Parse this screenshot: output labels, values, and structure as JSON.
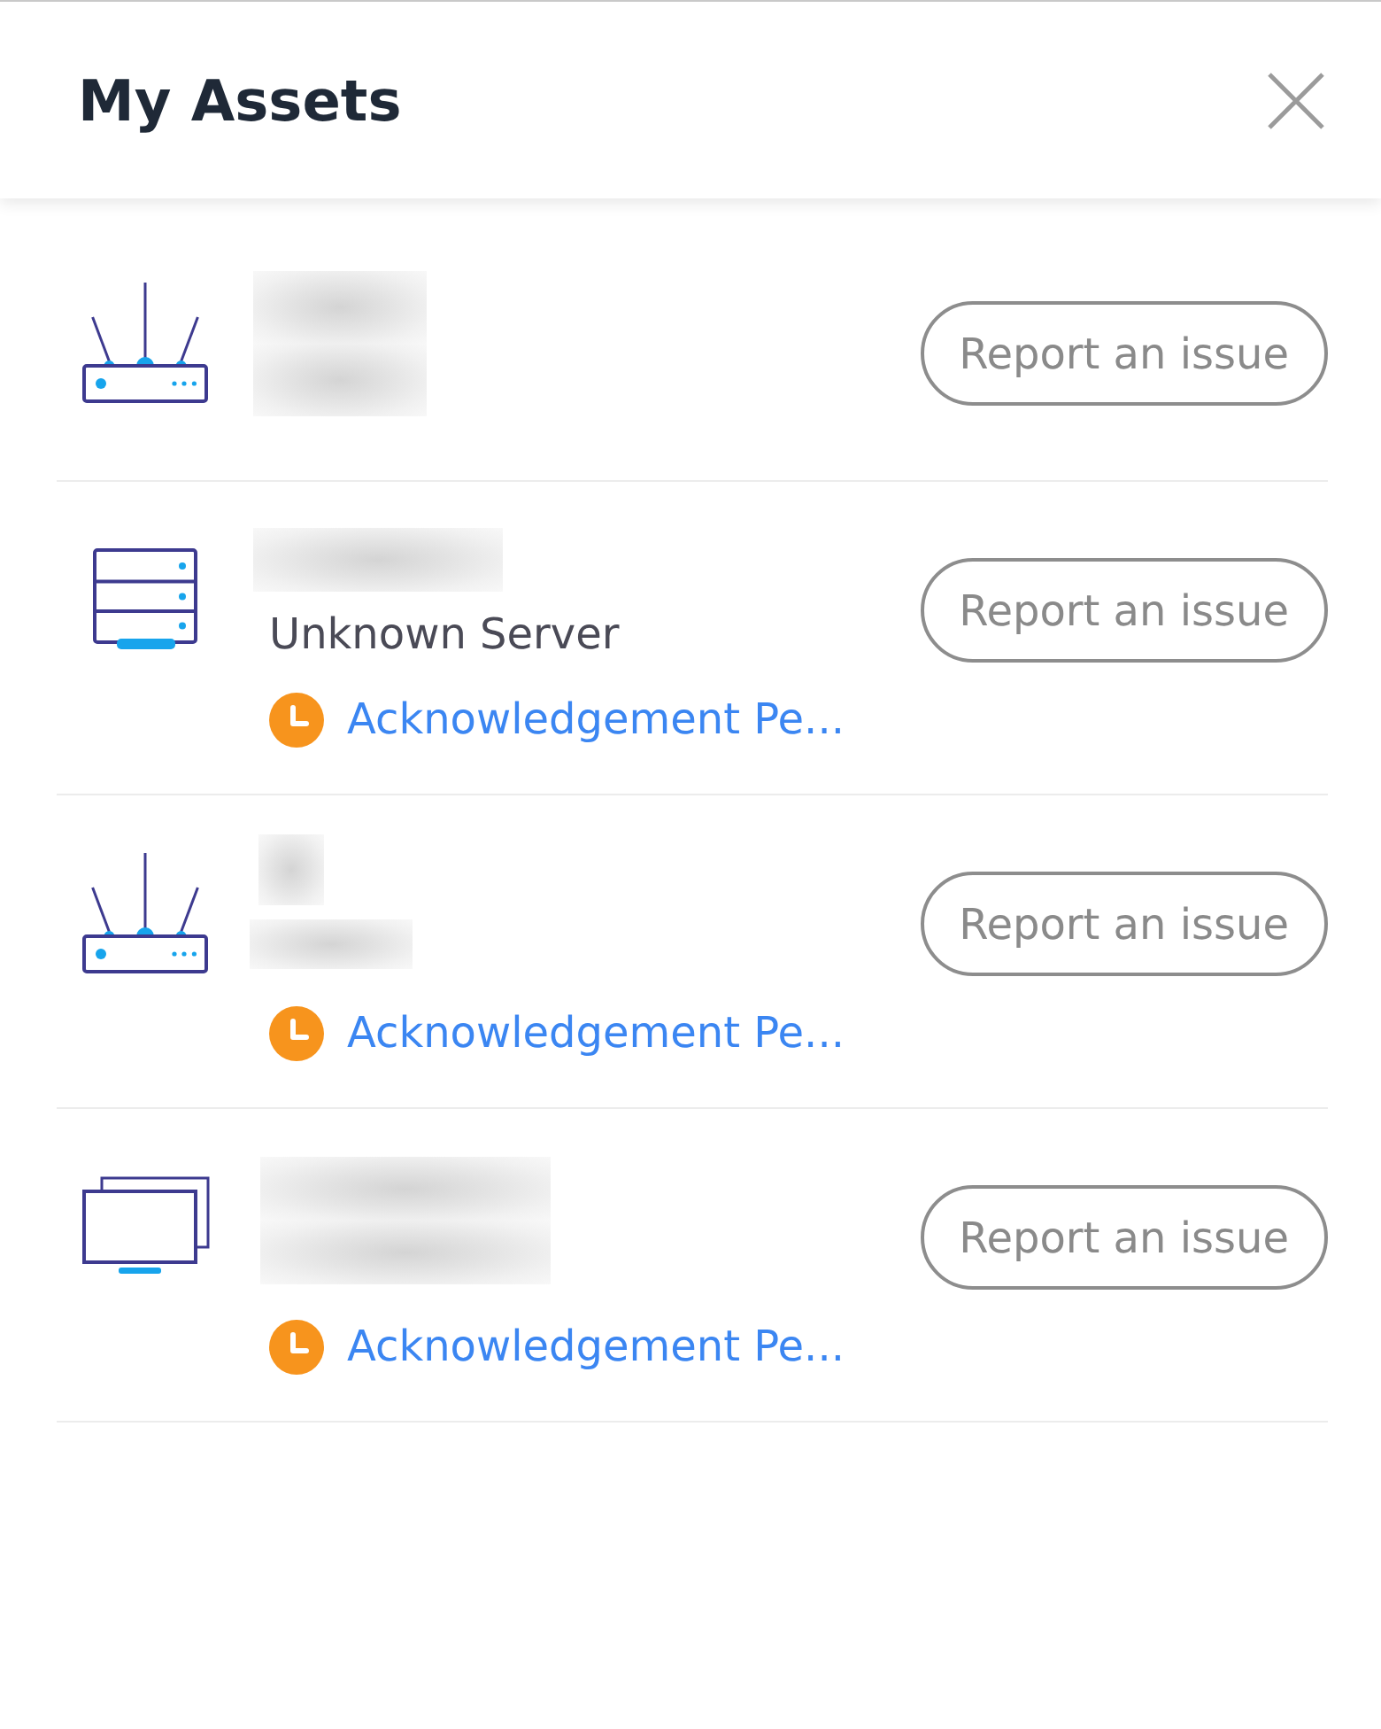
{
  "header": {
    "title": "My Assets"
  },
  "assets": [
    {
      "kind": "router",
      "name_blurred": true,
      "detail_blurred": true,
      "action": "Report an issue"
    },
    {
      "kind": "server",
      "name_blurred": true,
      "detail_blurred": false,
      "detail": "Unknown Server",
      "status": {
        "text": "Acknowledgement Pe..."
      },
      "action": "Report an issue"
    },
    {
      "kind": "router",
      "name_blurred": true,
      "detail_blurred": true,
      "status": {
        "text": "Acknowledgement Pe..."
      },
      "action": "Report an issue"
    },
    {
      "kind": "monitor",
      "name_blurred": true,
      "detail_blurred": true,
      "status": {
        "text": "Acknowledgement Pe..."
      },
      "action": "Report an issue"
    }
  ]
}
